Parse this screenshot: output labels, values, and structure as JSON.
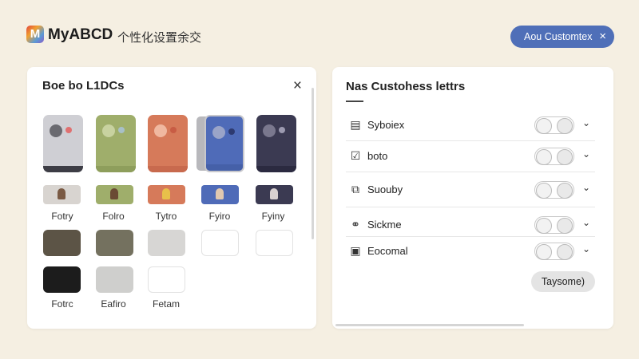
{
  "header": {
    "logo_letter": "M",
    "title": "MyABCD",
    "subtitle": "个性化设置余交",
    "button_label": "Aou Customtex",
    "button_close": "×"
  },
  "left_panel": {
    "title": "Boe bo L1DCs",
    "close": "×",
    "phones": [
      {
        "bg": "#cfcfd4",
        "c1": "#6a6a70",
        "c2": "#e07070",
        "bar": "#3d3d45"
      },
      {
        "bg": "#9fae6b",
        "c1": "#c8d2a0",
        "c2": "#a8c0c8",
        "bar": "#8e9e5c"
      },
      {
        "bg": "#d67a5a",
        "c1": "#f0b8a0",
        "c2": "#c85c44",
        "bar": "#c86a4e"
      },
      {
        "bg": "#4f6bb8",
        "c1": "#9aa4c8",
        "c2": "#2d3a70",
        "bar": "#4560a8"
      },
      {
        "bg": "#3b3a52",
        "c1": "#7a788e",
        "c2": "#9c9ab0",
        "bar": "#2b2a40"
      }
    ],
    "thumbs": [
      {
        "bg": "#d8d4d0",
        "fig": "#7a5a44"
      },
      {
        "bg": "#9fae6b",
        "fig": "#6a4a34"
      },
      {
        "bg": "#d67a5a",
        "fig": "#e8c04a"
      },
      {
        "bg": "#4f6bb8",
        "fig": "#e0c8b0"
      },
      {
        "bg": "#3b3a52",
        "fig": "#d8d0d0"
      }
    ],
    "labels_row1": [
      "Fotry",
      "Folro",
      "Tytro",
      "Fyiro",
      "Fyiny"
    ],
    "swatches_row2": [
      "#5c5446",
      "#74715f",
      "#d7d6d4",
      "#ffffff",
      "#ffffff"
    ],
    "swatches_row3": [
      "#1c1c1c",
      "#cfcfcd",
      "#ffffff"
    ],
    "labels_row3": [
      "Fotrc",
      "Eafiro",
      "Fetam"
    ]
  },
  "right_panel": {
    "title": "Nas Custohess lettrs",
    "rows": [
      {
        "icon": "▤",
        "label": "Syboiex"
      },
      {
        "icon": "☑",
        "label": "boto"
      },
      {
        "icon": "⧉",
        "label": "Suouby"
      },
      {
        "icon": "⚭",
        "label": "Sickme"
      },
      {
        "icon": "▣",
        "label": "Eocomal"
      }
    ],
    "chevron": "⌄",
    "save_label": "Taysome)"
  }
}
